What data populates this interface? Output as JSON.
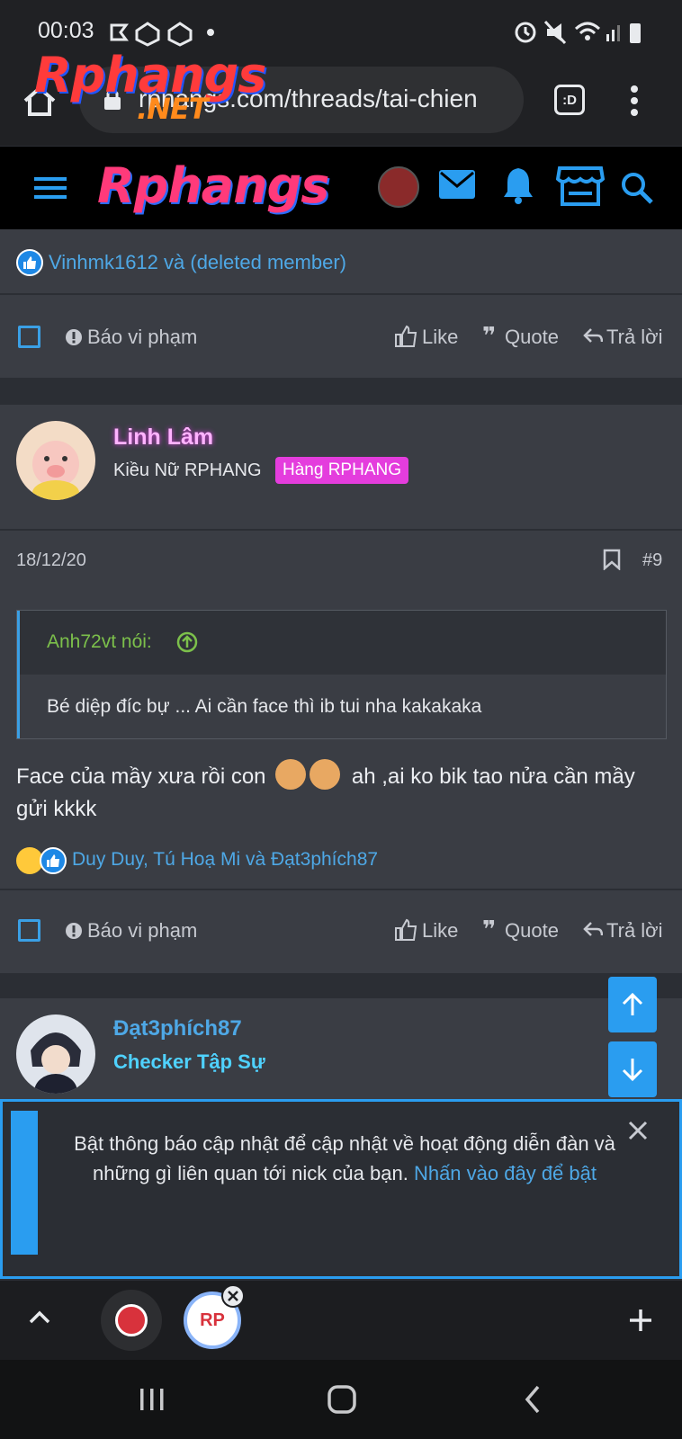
{
  "status_bar": {
    "time": "00:03"
  },
  "browser": {
    "logo_main": "Rphangs",
    "logo_sub": ".NET",
    "url": "rphangs.com/threads/tai-chien",
    "tab_icon": ":D"
  },
  "site": {
    "logo": "Rphangs"
  },
  "prev_post": {
    "reactions_text": "Vinhmk1612 và (deleted member)",
    "actions": {
      "report": "Báo vi phạm",
      "like": "Like",
      "quote": "Quote",
      "reply": "Trả lời"
    }
  },
  "post9": {
    "author": "Linh Lâm",
    "user_title": "Kiều Nữ RPHANG",
    "badge": "Hàng RPHANG",
    "date": "18/12/20",
    "number": "#9",
    "quote_author": "Anh72vt nói:",
    "quote_text": "Bé diệp đíc bự ... Ai cần face thì ib tui nha kakakaka",
    "body_part1": "Face của mầy xưa rồi con",
    "body_part2": "ah ,ai ko bik tao nửa cần mầy gửi kkkk",
    "reactions_text": "Duy Duy, Tú Hoạ Mi và Đạt3phích87",
    "actions": {
      "report": "Báo vi phạm",
      "like": "Like",
      "quote": "Quote",
      "reply": "Trả lời"
    }
  },
  "post10": {
    "author": "Đạt3phích87",
    "user_title": "Checker Tập Sự"
  },
  "notification": {
    "text": "Bật thông báo cập nhật để cập nhật về hoạt động diễn đàn và những gì liên quan tới nick của bạn.",
    "link": "Nhấn vào đây để bật"
  },
  "bubbles": {
    "rp_label": "RP"
  }
}
